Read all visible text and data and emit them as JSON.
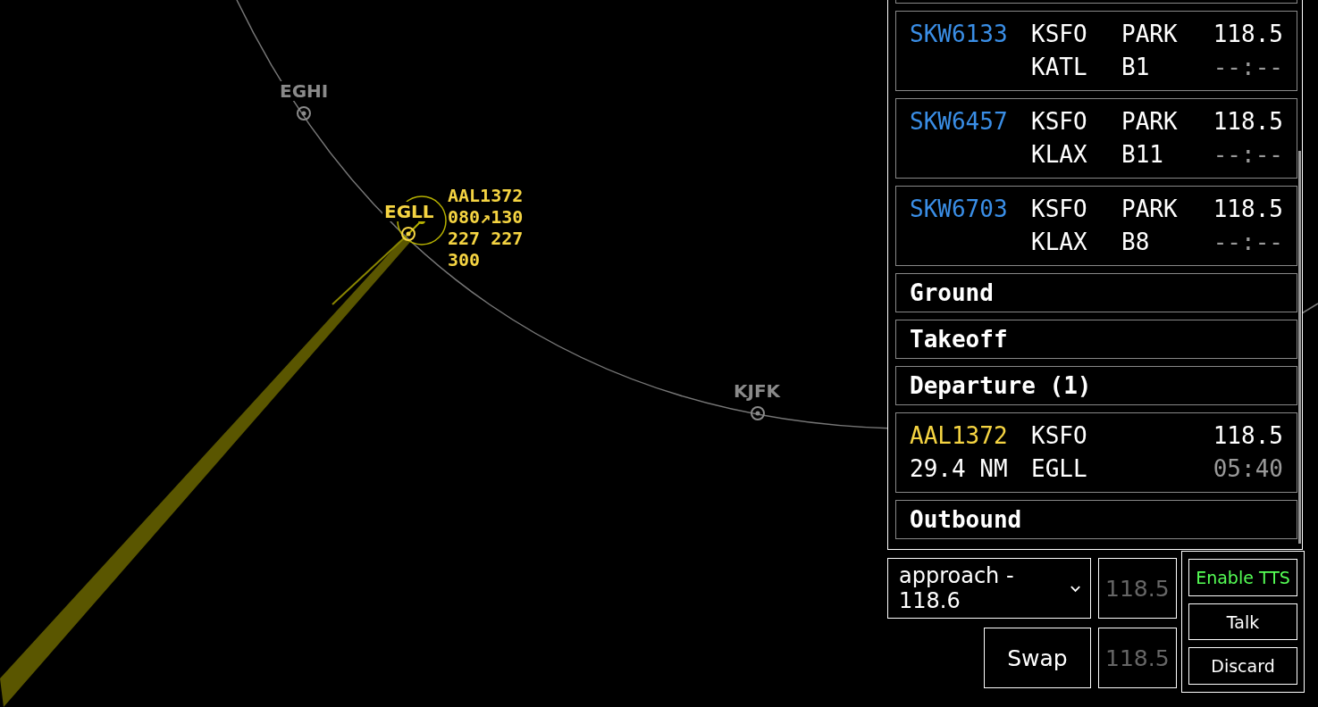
{
  "map": {
    "fixes": [
      {
        "label": "EGHI",
        "color": "#8a8a8a"
      },
      {
        "label": "KJFK",
        "color": "#8a8a8a"
      },
      {
        "label": "EGLL",
        "color": "#f5d442"
      }
    ],
    "aircraft": {
      "lines": [
        "AAL1372",
        "080↗130",
        "227 227",
        "300"
      ]
    }
  },
  "strips": [
    {
      "kind": "strip",
      "callsign": "SKW6133",
      "color": "#3a8ee6",
      "origin": "KSFO",
      "status": "PARK",
      "frequency": "118.5",
      "destination": "KATL",
      "stand": "B1",
      "time": "--:--"
    },
    {
      "kind": "strip",
      "callsign": "SKW6457",
      "color": "#3a8ee6",
      "origin": "KSFO",
      "status": "PARK",
      "frequency": "118.5",
      "destination": "KLAX",
      "stand": "B11",
      "time": "--:--"
    },
    {
      "kind": "strip",
      "callsign": "SKW6703",
      "color": "#3a8ee6",
      "origin": "KSFO",
      "status": "PARK",
      "frequency": "118.5",
      "destination": "KLAX",
      "stand": "B8",
      "time": "--:--"
    },
    {
      "kind": "header",
      "label": "Ground"
    },
    {
      "kind": "header",
      "label": "Takeoff"
    },
    {
      "kind": "header",
      "label": "Departure (1)"
    },
    {
      "kind": "strip",
      "callsign": "AAL1372",
      "color": "#f5d442",
      "origin": "KSFO",
      "frequency": "118.5",
      "distance": "29.4 NM",
      "destination": "EGLL",
      "time": "05:40"
    },
    {
      "kind": "header",
      "label": "Outbound"
    }
  ],
  "radio": {
    "frequency_select": "approach - 118.6",
    "active_frequency": "118.5",
    "standby_frequency": "118.5",
    "swap": "Swap"
  },
  "voice": {
    "buttons": [
      {
        "label": "Enable TTS",
        "kind": "toggle",
        "on": false
      },
      {
        "label": "Talk",
        "kind": "action"
      },
      {
        "label": "Discard",
        "kind": "action"
      }
    ]
  }
}
